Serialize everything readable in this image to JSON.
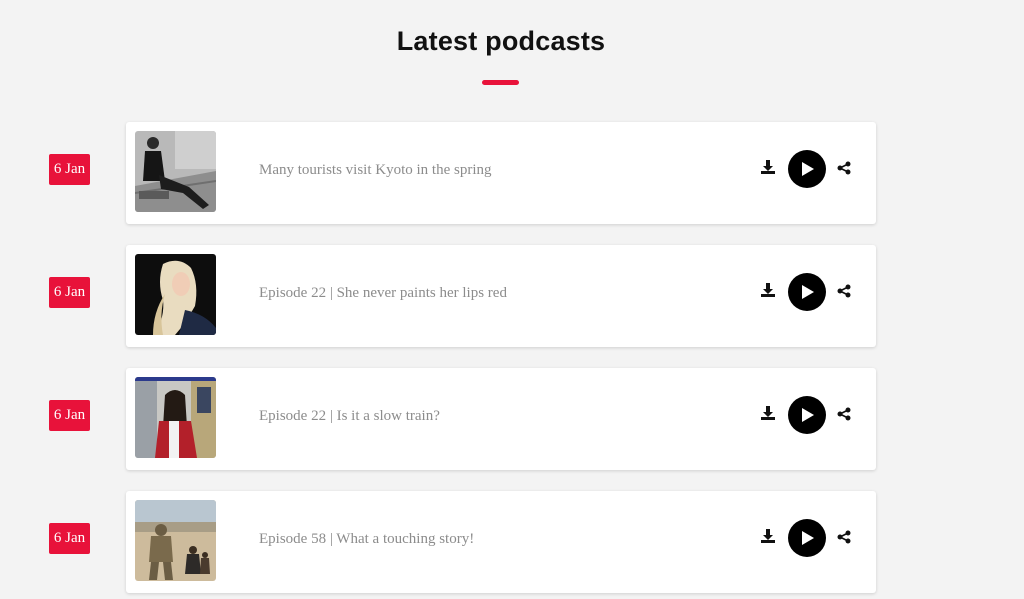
{
  "header": {
    "title": "Latest podcasts"
  },
  "colors": {
    "accent": "#e8123a",
    "play_button": "#000000",
    "background": "#f3f3f3"
  },
  "episodes": [
    {
      "date": "6 Jan",
      "title": "Many tourists visit Kyoto in the spring",
      "thumbnail": "man-sitting-on-steps"
    },
    {
      "date": "6 Jan",
      "title": "Episode 22 | She never paints her lips red",
      "thumbnail": "blonde-woman"
    },
    {
      "date": "6 Jan",
      "title": "Episode 22 | Is it a slow train?",
      "thumbnail": "woman-at-train"
    },
    {
      "date": "6 Jan",
      "title": "Episode 58 | What a touching story!",
      "thumbnail": "soldier-with-children"
    }
  ],
  "icons": {
    "download": "download-icon",
    "play": "play-icon",
    "share": "share-icon"
  }
}
